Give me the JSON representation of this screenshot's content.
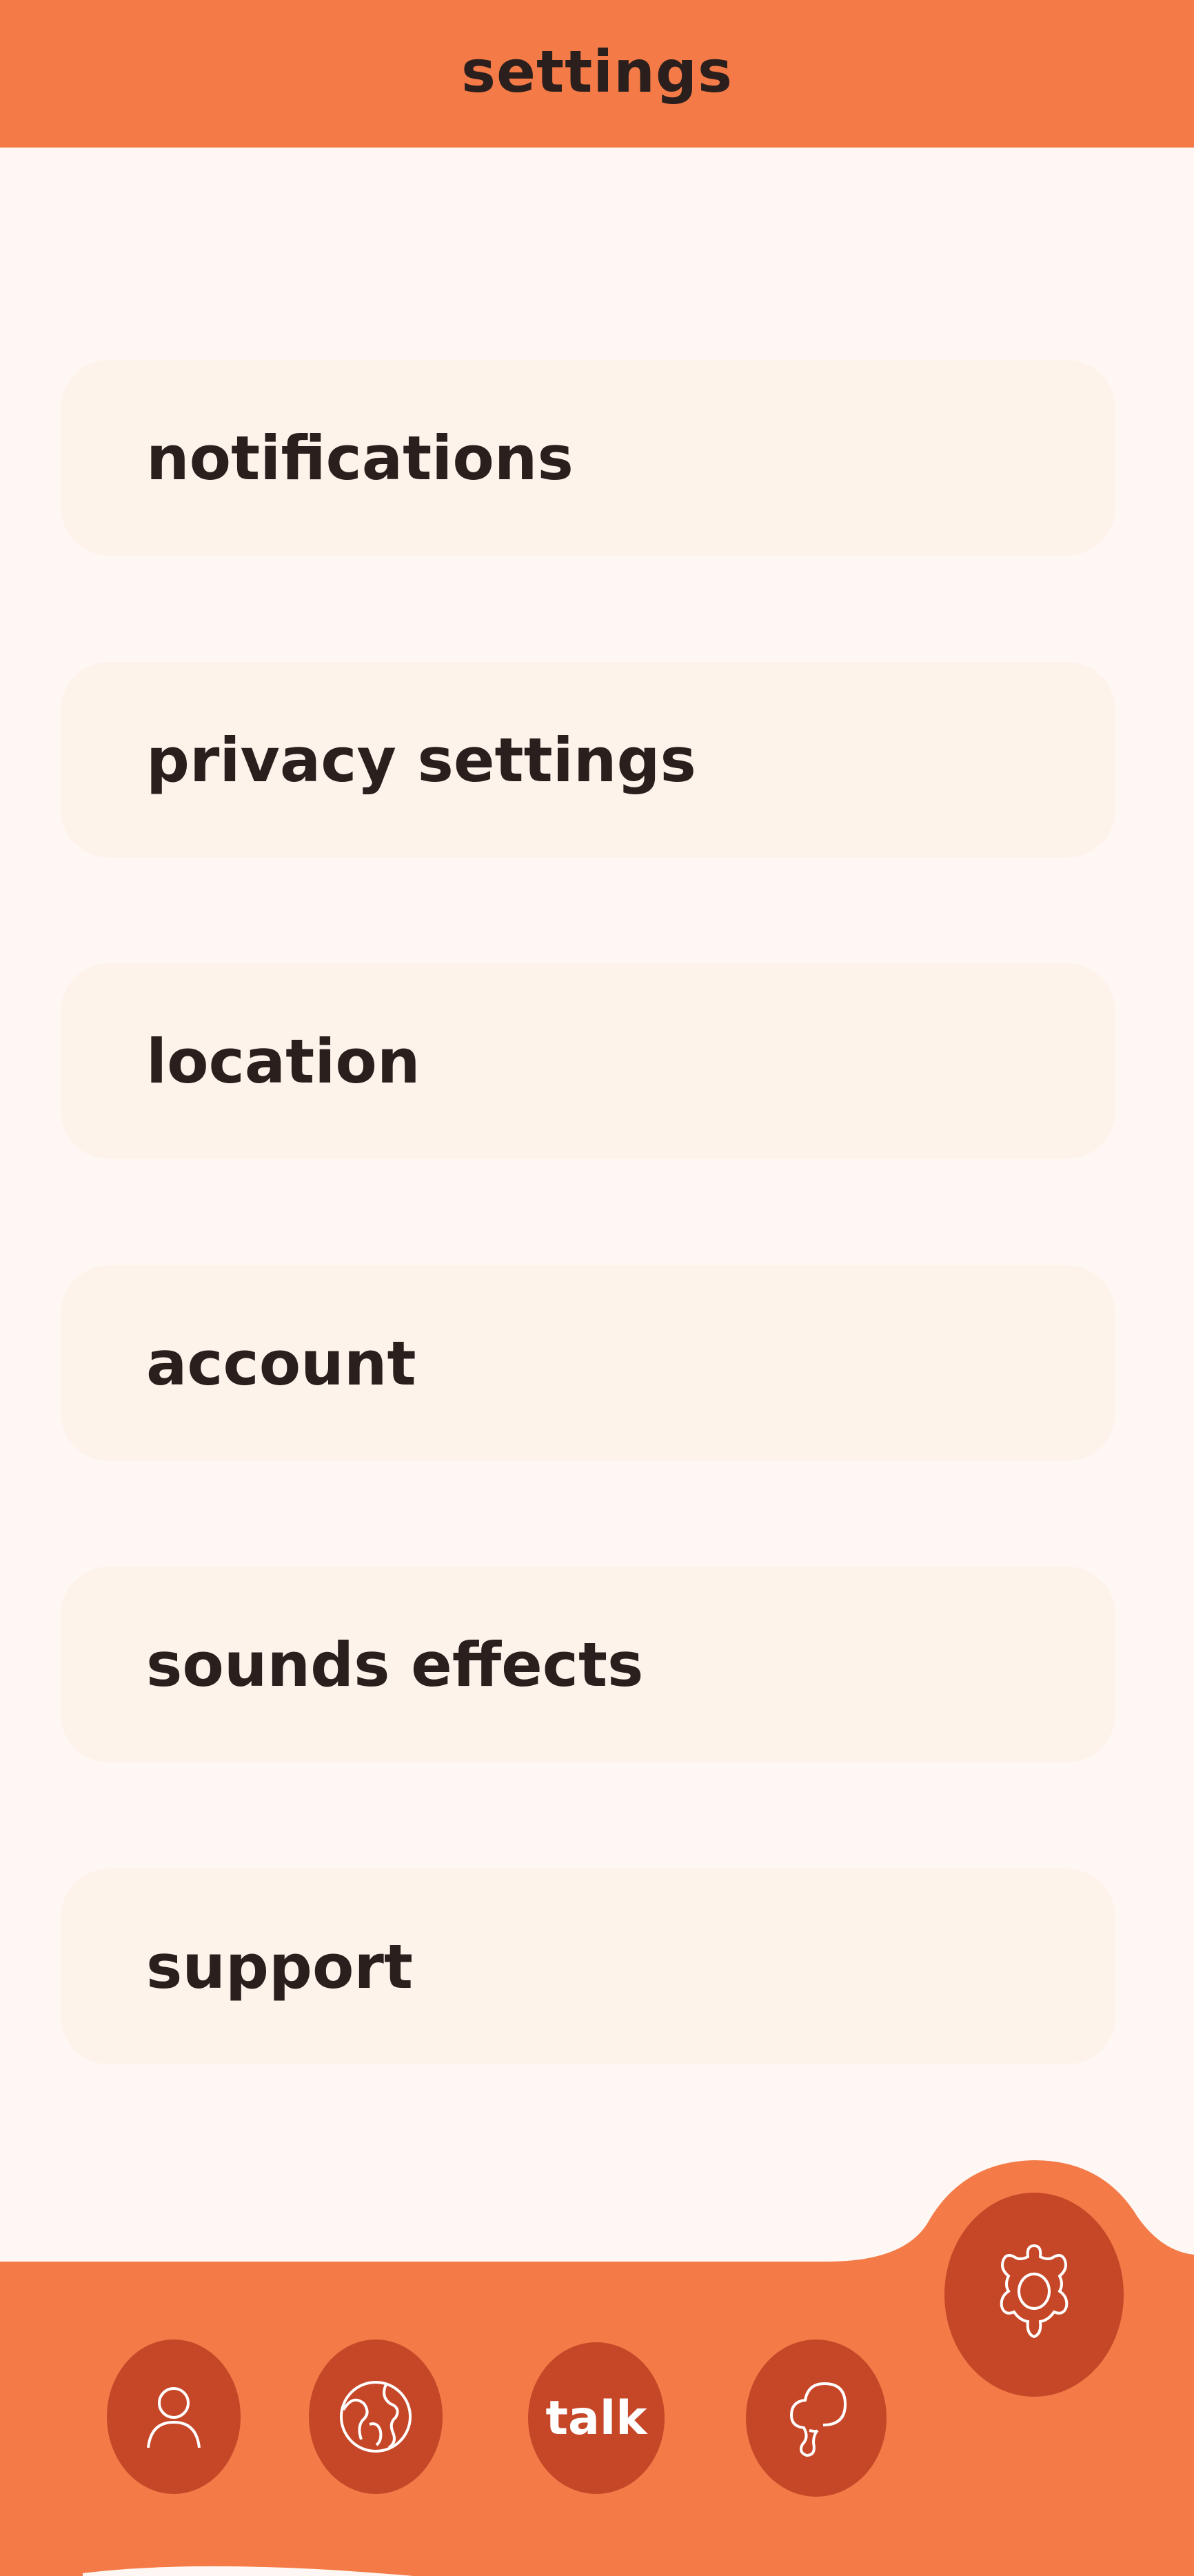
{
  "header": {
    "title": "settings"
  },
  "menu": [
    {
      "label": "notifications"
    },
    {
      "label": "privacy settings"
    },
    {
      "label": "location"
    },
    {
      "label": "account"
    },
    {
      "label": "sounds effects"
    },
    {
      "label": "support"
    }
  ],
  "bottom_nav": {
    "items": [
      {
        "icon": "person-icon"
      },
      {
        "icon": "globe-icon"
      },
      {
        "label": "talk"
      },
      {
        "icon": "mushroom-icon"
      }
    ],
    "active": {
      "icon": "gear-icon"
    }
  },
  "colors": {
    "accent": "#f47b47",
    "button": "#c64728",
    "background": "#fff7f4",
    "card": "#fdf3eb",
    "text": "#2a1f1d"
  }
}
